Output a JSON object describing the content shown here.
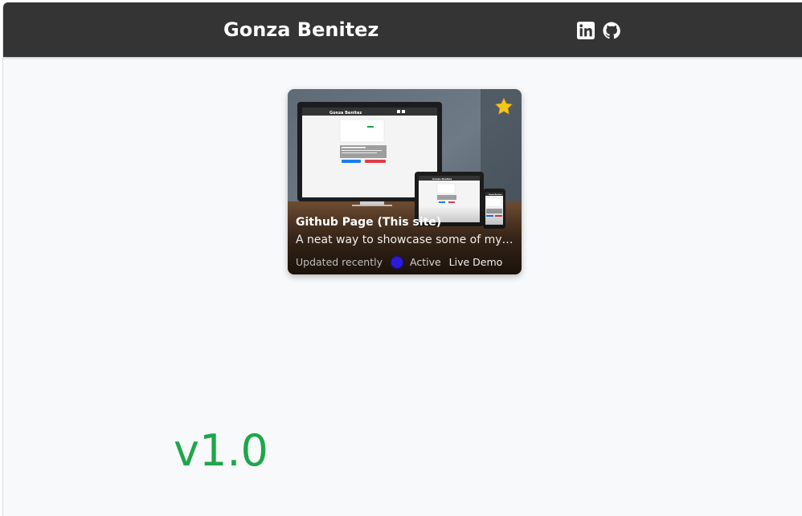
{
  "header": {
    "brand": "Gonza Benitez",
    "social": [
      {
        "name": "linkedin-icon"
      },
      {
        "name": "github-icon"
      }
    ]
  },
  "project_card": {
    "title": "Github Page (This site)",
    "description": "A neat way to showcase some of my …",
    "updated": "Updated recently",
    "status": "Active",
    "live_demo": "Live Demo",
    "favorite_icon": "star-icon",
    "screenshot_texts": {
      "laptop_title": "Gonza Benitez",
      "tablet_title": "Gonza Benitez",
      "phone_title": "Gonza Benitez"
    }
  },
  "footer": {
    "version": "v1.0"
  },
  "colors": {
    "navbar": "#343434",
    "page_background": "#f7f9fb",
    "version_text": "#1fa64a",
    "status_dot": "#2d1bd6",
    "star": "#f5c518"
  }
}
